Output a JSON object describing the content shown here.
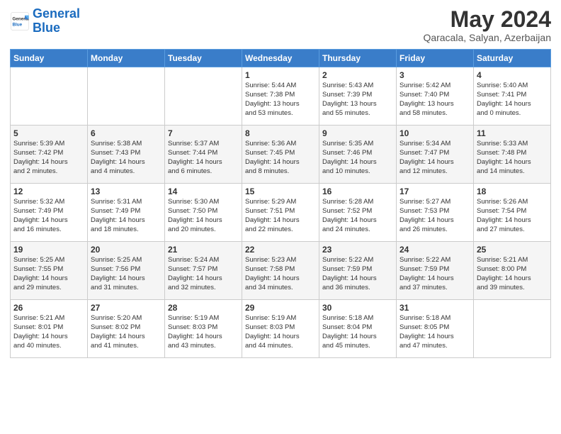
{
  "header": {
    "logo_general": "General",
    "logo_blue": "Blue",
    "month_title": "May 2024",
    "location": "Qaracala, Salyan, Azerbaijan"
  },
  "days_of_week": [
    "Sunday",
    "Monday",
    "Tuesday",
    "Wednesday",
    "Thursday",
    "Friday",
    "Saturday"
  ],
  "weeks": [
    [
      {
        "day": "",
        "info": ""
      },
      {
        "day": "",
        "info": ""
      },
      {
        "day": "",
        "info": ""
      },
      {
        "day": "1",
        "info": "Sunrise: 5:44 AM\nSunset: 7:38 PM\nDaylight: 13 hours\nand 53 minutes."
      },
      {
        "day": "2",
        "info": "Sunrise: 5:43 AM\nSunset: 7:39 PM\nDaylight: 13 hours\nand 55 minutes."
      },
      {
        "day": "3",
        "info": "Sunrise: 5:42 AM\nSunset: 7:40 PM\nDaylight: 13 hours\nand 58 minutes."
      },
      {
        "day": "4",
        "info": "Sunrise: 5:40 AM\nSunset: 7:41 PM\nDaylight: 14 hours\nand 0 minutes."
      }
    ],
    [
      {
        "day": "5",
        "info": "Sunrise: 5:39 AM\nSunset: 7:42 PM\nDaylight: 14 hours\nand 2 minutes."
      },
      {
        "day": "6",
        "info": "Sunrise: 5:38 AM\nSunset: 7:43 PM\nDaylight: 14 hours\nand 4 minutes."
      },
      {
        "day": "7",
        "info": "Sunrise: 5:37 AM\nSunset: 7:44 PM\nDaylight: 14 hours\nand 6 minutes."
      },
      {
        "day": "8",
        "info": "Sunrise: 5:36 AM\nSunset: 7:45 PM\nDaylight: 14 hours\nand 8 minutes."
      },
      {
        "day": "9",
        "info": "Sunrise: 5:35 AM\nSunset: 7:46 PM\nDaylight: 14 hours\nand 10 minutes."
      },
      {
        "day": "10",
        "info": "Sunrise: 5:34 AM\nSunset: 7:47 PM\nDaylight: 14 hours\nand 12 minutes."
      },
      {
        "day": "11",
        "info": "Sunrise: 5:33 AM\nSunset: 7:48 PM\nDaylight: 14 hours\nand 14 minutes."
      }
    ],
    [
      {
        "day": "12",
        "info": "Sunrise: 5:32 AM\nSunset: 7:49 PM\nDaylight: 14 hours\nand 16 minutes."
      },
      {
        "day": "13",
        "info": "Sunrise: 5:31 AM\nSunset: 7:49 PM\nDaylight: 14 hours\nand 18 minutes."
      },
      {
        "day": "14",
        "info": "Sunrise: 5:30 AM\nSunset: 7:50 PM\nDaylight: 14 hours\nand 20 minutes."
      },
      {
        "day": "15",
        "info": "Sunrise: 5:29 AM\nSunset: 7:51 PM\nDaylight: 14 hours\nand 22 minutes."
      },
      {
        "day": "16",
        "info": "Sunrise: 5:28 AM\nSunset: 7:52 PM\nDaylight: 14 hours\nand 24 minutes."
      },
      {
        "day": "17",
        "info": "Sunrise: 5:27 AM\nSunset: 7:53 PM\nDaylight: 14 hours\nand 26 minutes."
      },
      {
        "day": "18",
        "info": "Sunrise: 5:26 AM\nSunset: 7:54 PM\nDaylight: 14 hours\nand 27 minutes."
      }
    ],
    [
      {
        "day": "19",
        "info": "Sunrise: 5:25 AM\nSunset: 7:55 PM\nDaylight: 14 hours\nand 29 minutes."
      },
      {
        "day": "20",
        "info": "Sunrise: 5:25 AM\nSunset: 7:56 PM\nDaylight: 14 hours\nand 31 minutes."
      },
      {
        "day": "21",
        "info": "Sunrise: 5:24 AM\nSunset: 7:57 PM\nDaylight: 14 hours\nand 32 minutes."
      },
      {
        "day": "22",
        "info": "Sunrise: 5:23 AM\nSunset: 7:58 PM\nDaylight: 14 hours\nand 34 minutes."
      },
      {
        "day": "23",
        "info": "Sunrise: 5:22 AM\nSunset: 7:59 PM\nDaylight: 14 hours\nand 36 minutes."
      },
      {
        "day": "24",
        "info": "Sunrise: 5:22 AM\nSunset: 7:59 PM\nDaylight: 14 hours\nand 37 minutes."
      },
      {
        "day": "25",
        "info": "Sunrise: 5:21 AM\nSunset: 8:00 PM\nDaylight: 14 hours\nand 39 minutes."
      }
    ],
    [
      {
        "day": "26",
        "info": "Sunrise: 5:21 AM\nSunset: 8:01 PM\nDaylight: 14 hours\nand 40 minutes."
      },
      {
        "day": "27",
        "info": "Sunrise: 5:20 AM\nSunset: 8:02 PM\nDaylight: 14 hours\nand 41 minutes."
      },
      {
        "day": "28",
        "info": "Sunrise: 5:19 AM\nSunset: 8:03 PM\nDaylight: 14 hours\nand 43 minutes."
      },
      {
        "day": "29",
        "info": "Sunrise: 5:19 AM\nSunset: 8:03 PM\nDaylight: 14 hours\nand 44 minutes."
      },
      {
        "day": "30",
        "info": "Sunrise: 5:18 AM\nSunset: 8:04 PM\nDaylight: 14 hours\nand 45 minutes."
      },
      {
        "day": "31",
        "info": "Sunrise: 5:18 AM\nSunset: 8:05 PM\nDaylight: 14 hours\nand 47 minutes."
      },
      {
        "day": "",
        "info": ""
      }
    ]
  ]
}
